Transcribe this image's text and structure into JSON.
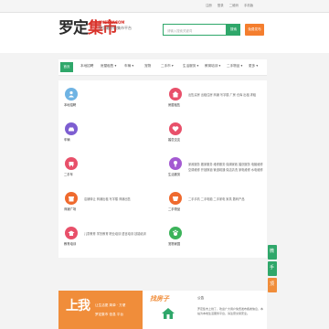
{
  "topbar": {
    "links": [
      "注册",
      "登录",
      "二维码",
      "手机版"
    ]
  },
  "header": {
    "logo_part1": "罗定",
    "logo_part2": "集市",
    "domain": "NYSTAY.COM",
    "slogan": "罗定最好的集市平台",
    "search_placeholder": "请输入搜索关键词",
    "search_button": "搜索",
    "post_button": "免费发布"
  },
  "nav": {
    "home": "首页",
    "items": [
      "本地招聘",
      "房屋租售 ▾",
      "车辆 ▾",
      "宠物",
      "二手市 ▾",
      "生活服务 ▾",
      "教育培训 ▾",
      "二手物品 ▾",
      "更多 ▾"
    ]
  },
  "categories": [
    {
      "title": "本地招聘",
      "color": "#6fb3e3",
      "icon": "person-icon",
      "links": [
        ""
      ]
    },
    {
      "title": "房屋租售",
      "color": "#e8506a",
      "icon": "house-icon",
      "links": [
        "出售买房",
        "出租住房",
        "商铺",
        "写字楼",
        "厂房",
        "仓库",
        "出租",
        "求租",
        "车位"
      ]
    },
    {
      "title": "车辆",
      "color": "#7d5ed1",
      "icon": "car-icon",
      "links": [
        ""
      ]
    },
    {
      "title": "婚恋交友",
      "color": "#e8506a",
      "icon": "heart-icon",
      "links": [
        ""
      ]
    },
    {
      "title": "二手车",
      "color": "#e8506a",
      "icon": "car-front-icon",
      "links": [
        ""
      ]
    },
    {
      "title": "生活服务",
      "color": "#a45ad2",
      "icon": "service-icon",
      "links": [
        "家政服务",
        "搬家服务",
        "维修服务",
        "保姆家政",
        "婚庆服务",
        "电脑维修",
        "空调维修",
        "开锁换锁",
        "管道疏通",
        "保洁清洗",
        "家电维修",
        "水电维修",
        "手机维修",
        "装修装饰",
        "家具维修",
        "上门维修",
        "空调"
      ]
    },
    {
      "title": "商铺广场",
      "color": "#ef6a2e",
      "icon": "shop-icon",
      "links": [
        "店铺转让",
        "商铺出租",
        "写字楼",
        "商铺出售",
        "旺铺招租"
      ]
    },
    {
      "title": "二手物品",
      "color": "#ef6a2e",
      "icon": "basket-icon",
      "links": [
        "二手手机",
        "二手电脑",
        "二手家电",
        "家具",
        "数码产品",
        "母婴用品",
        "服装鞋帽",
        "办公用品",
        "其他物品"
      ]
    },
    {
      "title": "教育培训",
      "color": "#e8506a",
      "icon": "school-icon",
      "links": [
        "儿童教育",
        "学历教育",
        "职业培训",
        "语言培训",
        "技能培训",
        "艺术培训",
        "其他培训"
      ]
    },
    {
      "title": "宠物家园",
      "color": "#3cb35a",
      "icon": "pet-icon",
      "links": [
        ""
      ]
    }
  ],
  "bottom": {
    "big_text": "上我",
    "slogan_line1": "让生活更 简单 · 方便",
    "slogan_line2": "罗定集市 信息 平台",
    "side_text": "找房子",
    "notice_title": "公告",
    "notice_text": "罗定集市上线了，欢迎广大用户免费发布各类信息，本站为本地生活服务平台，请注意交易安全。"
  },
  "side_buttons": [
    "微",
    "手",
    "顶"
  ]
}
